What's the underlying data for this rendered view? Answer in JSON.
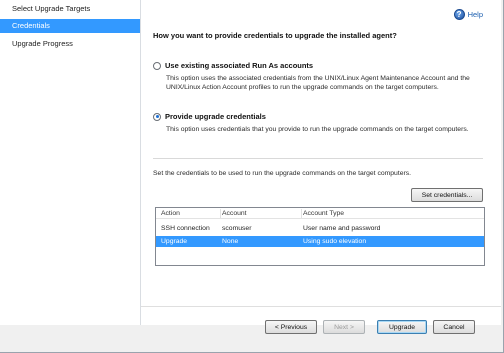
{
  "nav": {
    "items": [
      {
        "label": "Select Upgrade Targets",
        "active": false
      },
      {
        "label": "Credentials",
        "active": true
      },
      {
        "label": "Upgrade Progress",
        "active": false
      }
    ]
  },
  "help": {
    "label": "Help"
  },
  "main": {
    "question": "How you want to provide credentials to upgrade the installed agent?",
    "option1": {
      "label": "Use existing associated Run As accounts",
      "description": "This option uses the associated credentials from the UNIX/Linux Agent Maintenance Account and the UNIX/Linux Action Account profiles to run the upgrade commands on the target computers.",
      "checked": false
    },
    "option2": {
      "label": "Provide upgrade credentials",
      "description": "This option uses credentials that you provide to run the upgrade commands on the target computers.",
      "checked": true
    },
    "set_text": "Set the credentials to be used to run the upgrade commands on the target computers.",
    "set_credentials_label": "Set credentials...",
    "table": {
      "headers": [
        "Action",
        "Account",
        "Account Type"
      ],
      "rows": [
        [
          "SSH connection",
          "scomuser",
          "User name and password"
        ],
        [
          "Upgrade",
          "None",
          "Using sudo elevation"
        ]
      ],
      "selected_row": 1
    }
  },
  "footer": {
    "previous_label": "< Previous",
    "next_label": "Next >",
    "upgrade_label": "Upgrade",
    "cancel_label": "Cancel"
  },
  "colors": {
    "selection": "#3399ff",
    "help_link": "#1c5fb0"
  }
}
